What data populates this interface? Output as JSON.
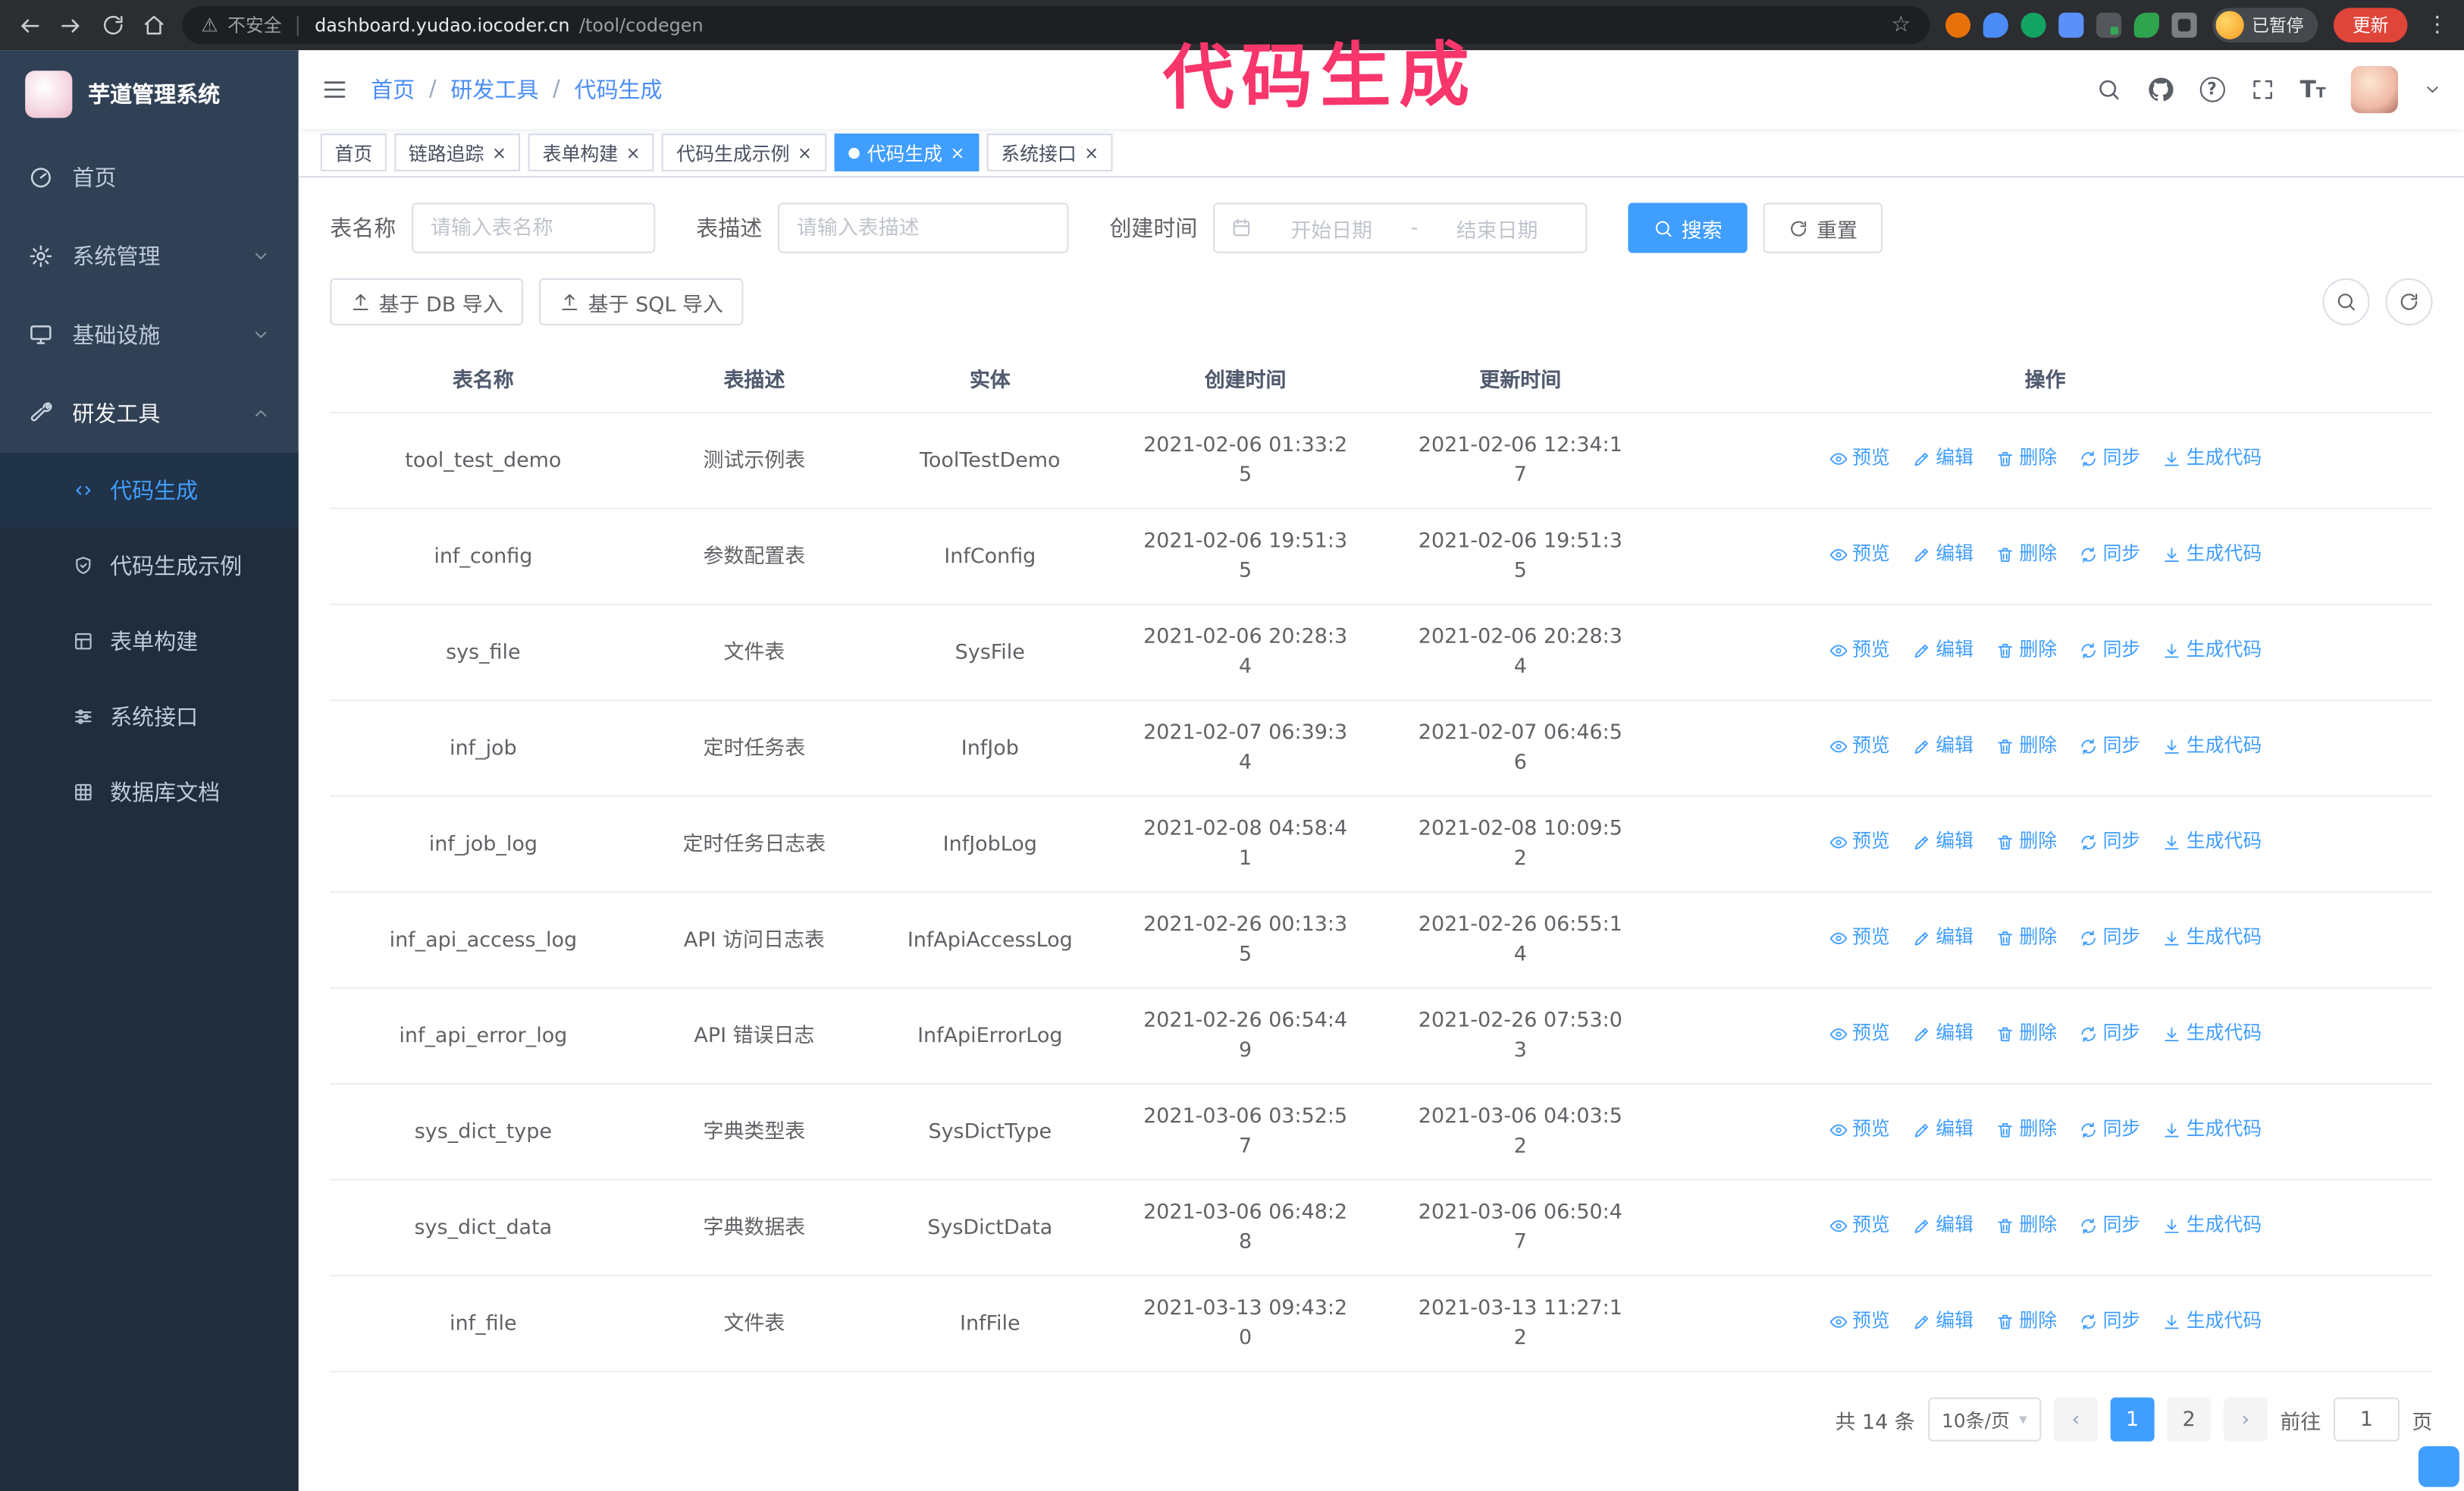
{
  "colors": {
    "accent": "#409eff",
    "sidebar_bg": "#304156",
    "submenu_bg": "#1f2d3d",
    "annotation": "#f8366b",
    "update_btn": "#e0453a"
  },
  "annotation": {
    "text": "代码生成"
  },
  "browser": {
    "security_label": "不安全",
    "url_host": "dashboard.yudao.iocoder.cn",
    "url_path": "/tool/codegen",
    "profile_badge": "已暂停",
    "update_label": "更新"
  },
  "sidebar": {
    "logo_title": "芋道管理系统",
    "items": [
      {
        "label": "首页"
      },
      {
        "label": "系统管理"
      },
      {
        "label": "基础设施"
      },
      {
        "label": "研发工具"
      }
    ],
    "submenu": [
      {
        "label": "代码生成"
      },
      {
        "label": "代码生成示例"
      },
      {
        "label": "表单构建"
      },
      {
        "label": "系统接口"
      },
      {
        "label": "数据库文档"
      }
    ]
  },
  "header": {
    "breadcrumb": [
      "首页",
      "研发工具",
      "代码生成"
    ]
  },
  "tabs": [
    {
      "label": "首页"
    },
    {
      "label": "链路追踪"
    },
    {
      "label": "表单构建"
    },
    {
      "label": "代码生成示例"
    },
    {
      "label": "代码生成"
    },
    {
      "label": "系统接口"
    }
  ],
  "filters": {
    "table_name_label": "表名称",
    "table_name_placeholder": "请输入表名称",
    "table_desc_label": "表描述",
    "table_desc_placeholder": "请输入表描述",
    "create_time_label": "创建时间",
    "start_placeholder": "开始日期",
    "range_separator": "-",
    "end_placeholder": "结束日期",
    "search_label": "搜索",
    "reset_label": "重置"
  },
  "toolbar": {
    "import_db_label": "基于 DB 导入",
    "import_sql_label": "基于 SQL 导入"
  },
  "table": {
    "columns": [
      "表名称",
      "表描述",
      "实体",
      "创建时间",
      "更新时间",
      "操作"
    ],
    "row_actions": [
      "预览",
      "编辑",
      "删除",
      "同步",
      "生成代码"
    ],
    "rows": [
      {
        "name": "tool_test_demo",
        "desc": "测试示例表",
        "entity": "ToolTestDemo",
        "create_time": "2021-02-06 01:33:25",
        "update_time": "2021-02-06 12:34:17"
      },
      {
        "name": "inf_config",
        "desc": "参数配置表",
        "entity": "InfConfig",
        "create_time": "2021-02-06 19:51:35",
        "update_time": "2021-02-06 19:51:35"
      },
      {
        "name": "sys_file",
        "desc": "文件表",
        "entity": "SysFile",
        "create_time": "2021-02-06 20:28:34",
        "update_time": "2021-02-06 20:28:34"
      },
      {
        "name": "inf_job",
        "desc": "定时任务表",
        "entity": "InfJob",
        "create_time": "2021-02-07 06:39:34",
        "update_time": "2021-02-07 06:46:56"
      },
      {
        "name": "inf_job_log",
        "desc": "定时任务日志表",
        "entity": "InfJobLog",
        "create_time": "2021-02-08 04:58:41",
        "update_time": "2021-02-08 10:09:52"
      },
      {
        "name": "inf_api_access_log",
        "desc": "API 访问日志表",
        "entity": "InfApiAccessLog",
        "create_time": "2021-02-26 00:13:35",
        "update_time": "2021-02-26 06:55:14"
      },
      {
        "name": "inf_api_error_log",
        "desc": "API 错误日志",
        "entity": "InfApiErrorLog",
        "create_time": "2021-02-26 06:54:49",
        "update_time": "2021-02-26 07:53:03"
      },
      {
        "name": "sys_dict_type",
        "desc": "字典类型表",
        "entity": "SysDictType",
        "create_time": "2021-03-06 03:52:57",
        "update_time": "2021-03-06 04:03:52"
      },
      {
        "name": "sys_dict_data",
        "desc": "字典数据表",
        "entity": "SysDictData",
        "create_time": "2021-03-06 06:48:28",
        "update_time": "2021-03-06 06:50:47"
      },
      {
        "name": "inf_file",
        "desc": "文件表",
        "entity": "InfFile",
        "create_time": "2021-03-13 09:43:20",
        "update_time": "2021-03-13 11:27:12"
      }
    ]
  },
  "pagination": {
    "total": "共 14 条",
    "page_size": "10条/页",
    "prev": "‹",
    "next": "›",
    "pages": [
      "1",
      "2"
    ],
    "active_page": "1",
    "goto_prefix": "前往",
    "goto_value": "1",
    "goto_suffix": "页"
  }
}
